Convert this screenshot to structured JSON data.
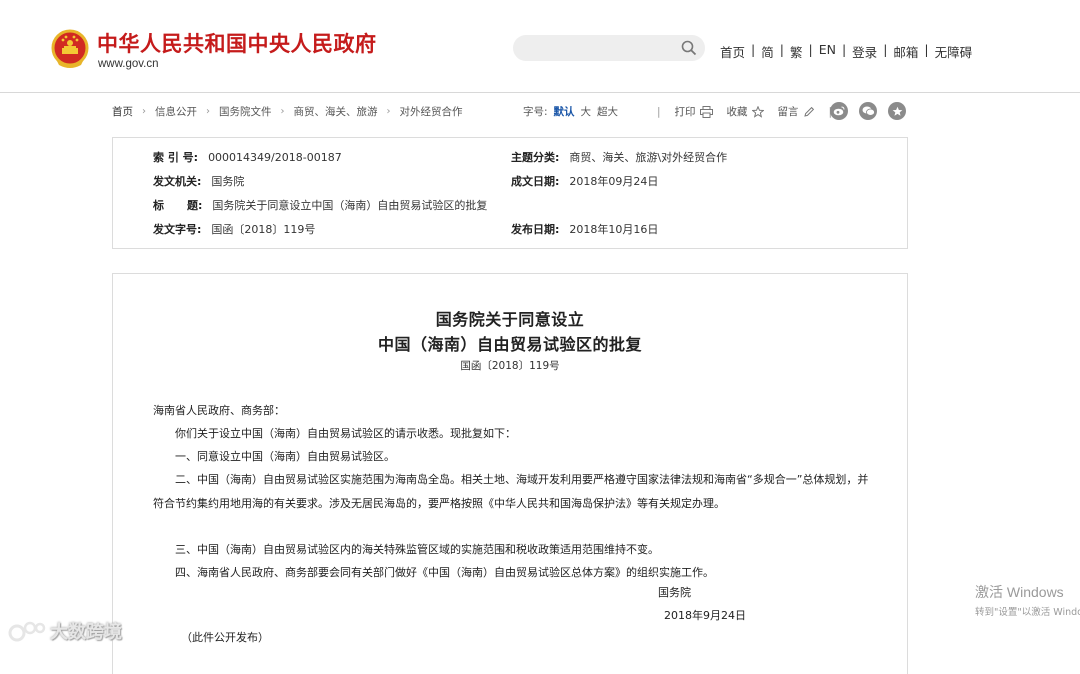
{
  "header": {
    "site_title": "中华人民共和国中央人民政府",
    "site_url": "www.gov.cn",
    "search": {
      "placeholder": ""
    },
    "nav": [
      "首页",
      "简",
      "繁",
      "EN",
      "登录",
      "邮箱",
      "无障碍"
    ]
  },
  "toolbar": {
    "breadcrumbs": [
      "首页",
      "信息公开",
      "国务院文件",
      "商贸、海关、旅游",
      "对外经贸合作"
    ],
    "fontsize_label": "字号:",
    "fontsize_options": [
      "默认",
      "大",
      "超大"
    ],
    "fontsize_selected": "默认",
    "print_label": "打印",
    "favorite_label": "收藏",
    "comment_label": "留言",
    "share_icons": [
      "weibo-icon",
      "wechat-icon",
      "star-icon"
    ]
  },
  "info": {
    "index_key": "索 引 号:",
    "index_val": "000014349/2018-00187",
    "category_key": "主题分类:",
    "category_val": "商贸、海关、旅游\\对外经贸合作",
    "issuer_key": "发文机关:",
    "issuer_val": "国务院",
    "created_key": "成文日期:",
    "created_val": "2018年09月24日",
    "title_key": "标      题:",
    "title_val": "国务院关于同意设立中国（海南）自由贸易试验区的批复",
    "docno_key": "发文字号:",
    "docno_val": "国函〔2018〕119号",
    "published_key": "发布日期:",
    "published_val": "2018年10月16日"
  },
  "article": {
    "title_line1": "国务院关于同意设立",
    "title_line2": "中国（海南）自由贸易试验区的批复",
    "doc_number": "国函〔2018〕119号",
    "salutation": "海南省人民政府、商务部：",
    "p1": "你们关于设立中国（海南）自由贸易试验区的请示收悉。现批复如下：",
    "p2": "一、同意设立中国（海南）自由贸易试验区。",
    "p3": "二、中国（海南）自由贸易试验区实施范围为海南岛全岛。相关土地、海域开发利用要严格遵守国家法律法规和海南省“多规合一”总体规划，并符合节约集约用地用海的有关要求。涉及无居民海岛的，要严格按照《中华人民共和国海岛保护法》等有关规定办理。",
    "p4": "三、中国（海南）自由贸易试验区内的海关特殊监管区域的实施范围和税收政策适用范围维持不变。",
    "p5": "四、海南省人民政府、商务部要会同有关部门做好《中国（海南）自由贸易试验区总体方案》的组织实施工作。",
    "signature": "国务院",
    "date": "2018年9月24日",
    "note": "（此件公开发布）"
  },
  "overlays": {
    "watermark_text": "大数跨境",
    "activate_title": "激活 Windows",
    "activate_sub": "转到\"设置\"以激活 Windows。"
  },
  "colors": {
    "brand_red": "#c51b1b",
    "link_blue": "#1a56a8"
  }
}
